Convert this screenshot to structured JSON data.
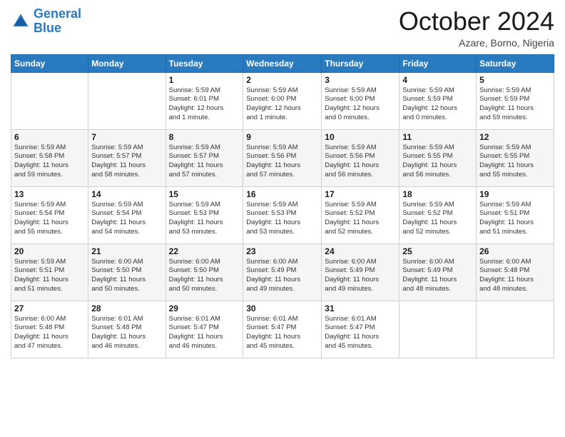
{
  "header": {
    "logo_line1": "General",
    "logo_line2": "Blue",
    "month": "October 2024",
    "location": "Azare, Borno, Nigeria"
  },
  "days_of_week": [
    "Sunday",
    "Monday",
    "Tuesday",
    "Wednesday",
    "Thursday",
    "Friday",
    "Saturday"
  ],
  "weeks": [
    [
      {
        "day": "",
        "info": ""
      },
      {
        "day": "",
        "info": ""
      },
      {
        "day": "1",
        "info": "Sunrise: 5:59 AM\nSunset: 6:01 PM\nDaylight: 12 hours\nand 1 minute."
      },
      {
        "day": "2",
        "info": "Sunrise: 5:59 AM\nSunset: 6:00 PM\nDaylight: 12 hours\nand 1 minute."
      },
      {
        "day": "3",
        "info": "Sunrise: 5:59 AM\nSunset: 6:00 PM\nDaylight: 12 hours\nand 0 minutes."
      },
      {
        "day": "4",
        "info": "Sunrise: 5:59 AM\nSunset: 5:59 PM\nDaylight: 12 hours\nand 0 minutes."
      },
      {
        "day": "5",
        "info": "Sunrise: 5:59 AM\nSunset: 5:59 PM\nDaylight: 11 hours\nand 59 minutes."
      }
    ],
    [
      {
        "day": "6",
        "info": "Sunrise: 5:59 AM\nSunset: 5:58 PM\nDaylight: 11 hours\nand 59 minutes."
      },
      {
        "day": "7",
        "info": "Sunrise: 5:59 AM\nSunset: 5:57 PM\nDaylight: 11 hours\nand 58 minutes."
      },
      {
        "day": "8",
        "info": "Sunrise: 5:59 AM\nSunset: 5:57 PM\nDaylight: 11 hours\nand 57 minutes."
      },
      {
        "day": "9",
        "info": "Sunrise: 5:59 AM\nSunset: 5:56 PM\nDaylight: 11 hours\nand 57 minutes."
      },
      {
        "day": "10",
        "info": "Sunrise: 5:59 AM\nSunset: 5:56 PM\nDaylight: 11 hours\nand 56 minutes."
      },
      {
        "day": "11",
        "info": "Sunrise: 5:59 AM\nSunset: 5:55 PM\nDaylight: 11 hours\nand 56 minutes."
      },
      {
        "day": "12",
        "info": "Sunrise: 5:59 AM\nSunset: 5:55 PM\nDaylight: 11 hours\nand 55 minutes."
      }
    ],
    [
      {
        "day": "13",
        "info": "Sunrise: 5:59 AM\nSunset: 5:54 PM\nDaylight: 11 hours\nand 55 minutes."
      },
      {
        "day": "14",
        "info": "Sunrise: 5:59 AM\nSunset: 5:54 PM\nDaylight: 11 hours\nand 54 minutes."
      },
      {
        "day": "15",
        "info": "Sunrise: 5:59 AM\nSunset: 5:53 PM\nDaylight: 11 hours\nand 53 minutes."
      },
      {
        "day": "16",
        "info": "Sunrise: 5:59 AM\nSunset: 5:53 PM\nDaylight: 11 hours\nand 53 minutes."
      },
      {
        "day": "17",
        "info": "Sunrise: 5:59 AM\nSunset: 5:52 PM\nDaylight: 11 hours\nand 52 minutes."
      },
      {
        "day": "18",
        "info": "Sunrise: 5:59 AM\nSunset: 5:52 PM\nDaylight: 11 hours\nand 52 minutes."
      },
      {
        "day": "19",
        "info": "Sunrise: 5:59 AM\nSunset: 5:51 PM\nDaylight: 11 hours\nand 51 minutes."
      }
    ],
    [
      {
        "day": "20",
        "info": "Sunrise: 5:59 AM\nSunset: 5:51 PM\nDaylight: 11 hours\nand 51 minutes."
      },
      {
        "day": "21",
        "info": "Sunrise: 6:00 AM\nSunset: 5:50 PM\nDaylight: 11 hours\nand 50 minutes."
      },
      {
        "day": "22",
        "info": "Sunrise: 6:00 AM\nSunset: 5:50 PM\nDaylight: 11 hours\nand 50 minutes."
      },
      {
        "day": "23",
        "info": "Sunrise: 6:00 AM\nSunset: 5:49 PM\nDaylight: 11 hours\nand 49 minutes."
      },
      {
        "day": "24",
        "info": "Sunrise: 6:00 AM\nSunset: 5:49 PM\nDaylight: 11 hours\nand 49 minutes."
      },
      {
        "day": "25",
        "info": "Sunrise: 6:00 AM\nSunset: 5:49 PM\nDaylight: 11 hours\nand 48 minutes."
      },
      {
        "day": "26",
        "info": "Sunrise: 6:00 AM\nSunset: 5:48 PM\nDaylight: 11 hours\nand 48 minutes."
      }
    ],
    [
      {
        "day": "27",
        "info": "Sunrise: 6:00 AM\nSunset: 5:48 PM\nDaylight: 11 hours\nand 47 minutes."
      },
      {
        "day": "28",
        "info": "Sunrise: 6:01 AM\nSunset: 5:48 PM\nDaylight: 11 hours\nand 46 minutes."
      },
      {
        "day": "29",
        "info": "Sunrise: 6:01 AM\nSunset: 5:47 PM\nDaylight: 11 hours\nand 46 minutes."
      },
      {
        "day": "30",
        "info": "Sunrise: 6:01 AM\nSunset: 5:47 PM\nDaylight: 11 hours\nand 45 minutes."
      },
      {
        "day": "31",
        "info": "Sunrise: 6:01 AM\nSunset: 5:47 PM\nDaylight: 11 hours\nand 45 minutes."
      },
      {
        "day": "",
        "info": ""
      },
      {
        "day": "",
        "info": ""
      }
    ]
  ]
}
